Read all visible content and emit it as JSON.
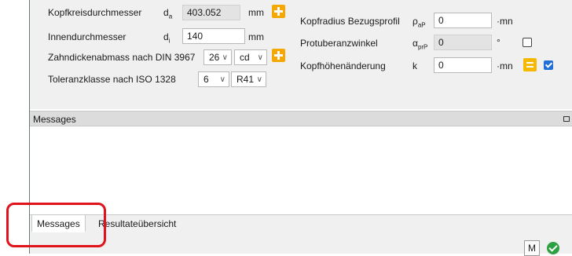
{
  "left_params": {
    "tip_diameter": {
      "label": "Kopfkreisdurchmesser",
      "symbol": "d",
      "symbol_sub": "a",
      "value": "403.052",
      "unit": "mm"
    },
    "inner_diameter": {
      "label": "Innendurchmesser",
      "symbol": "d",
      "symbol_sub": "i",
      "value": "140",
      "unit": "mm"
    },
    "tooth_thickness": {
      "label": "Zahndickenabmass nach DIN 3967",
      "select1": "26",
      "select2": "cd"
    },
    "tolerance": {
      "label": "Toleranzklasse nach ISO 1328",
      "select1": "6",
      "select2": "R41"
    }
  },
  "right_params": {
    "tip_radius": {
      "label": "Kopfradius Bezugsprofil",
      "symbol": "ρ",
      "symbol_sub": "aP",
      "value": "0",
      "unit": "·mn"
    },
    "protuberance_angle": {
      "label": "Protuberanzwinkel",
      "symbol": "α",
      "symbol_sub": "prP",
      "value": "0",
      "unit": "°",
      "checked": false
    },
    "tip_height_change": {
      "label": "Kopfhöhenänderung",
      "symbol": "k",
      "value": "0",
      "unit": "·mn",
      "checked": true
    }
  },
  "messages_panel": {
    "title": "Messages"
  },
  "bottom_tabs": [
    {
      "label": "Messages",
      "active": true
    },
    {
      "label": "Resultateübersicht",
      "active": false
    }
  ],
  "status_bar": {
    "m_button": "M"
  },
  "colors": {
    "accent_orange": "#f6a800",
    "highlight_red": "#e0121c",
    "checkbox_blue": "#1f6fd6",
    "ok_green": "#2ea043"
  }
}
